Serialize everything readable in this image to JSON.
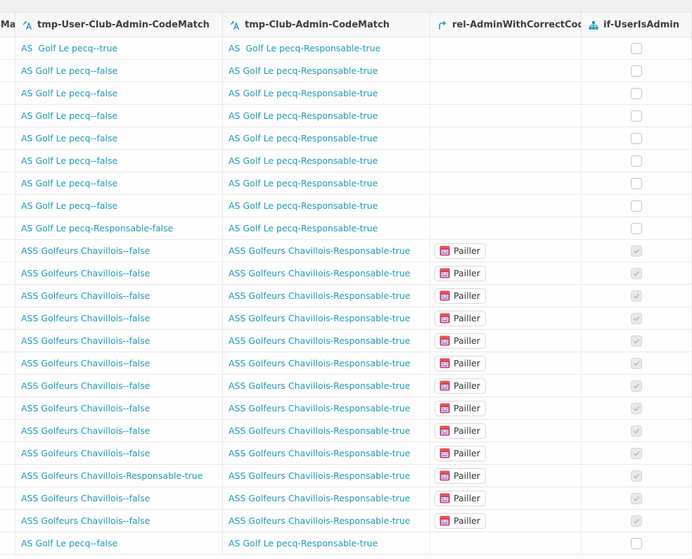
{
  "columns": {
    "cut": "eMa",
    "col1": "tmp-User-Club-Admin-CodeMatch",
    "col2": "tmp-Club-Admin-CodeMatch",
    "col3": "rel-AdminWithCorrectCode",
    "col4": "if-UserIsAdmin"
  },
  "icons": {
    "col1": "formula-text-icon",
    "col2": "formula-text-icon",
    "col3": "relation-arrow-icon",
    "col4": "hierarchy-icon",
    "chip": "calendar-avatar-icon"
  },
  "colors": {
    "link": "#1d9bb5",
    "header_icon": "#1d9bb5"
  },
  "rows": [
    {
      "a": "AS  Golf Le pecq--true",
      "b": "AS  Golf Le pecq-Responsable-true",
      "rel": "",
      "checked": false
    },
    {
      "a": "AS Golf Le pecq--false",
      "b": "AS Golf Le pecq-Responsable-true",
      "rel": "",
      "checked": false
    },
    {
      "a": "AS Golf Le pecq--false",
      "b": "AS Golf Le pecq-Responsable-true",
      "rel": "",
      "checked": false
    },
    {
      "a": "AS Golf Le pecq--false",
      "b": "AS Golf Le pecq-Responsable-true",
      "rel": "",
      "checked": false
    },
    {
      "a": "AS Golf Le pecq--false",
      "b": "AS Golf Le pecq-Responsable-true",
      "rel": "",
      "checked": false
    },
    {
      "a": "AS Golf Le pecq--false",
      "b": "AS Golf Le pecq-Responsable-true",
      "rel": "",
      "checked": false
    },
    {
      "a": "AS Golf Le pecq--false",
      "b": "AS Golf Le pecq-Responsable-true",
      "rel": "",
      "checked": false
    },
    {
      "a": "AS Golf Le pecq--false",
      "b": "AS Golf Le pecq-Responsable-true",
      "rel": "",
      "checked": false
    },
    {
      "a": "AS Golf Le pecq-Responsable-false",
      "b": "AS Golf Le pecq-Responsable-true",
      "rel": "",
      "checked": false
    },
    {
      "a": "ASS Golfeurs Chavillois--false",
      "b": "ASS Golfeurs Chavillois-Responsable-true",
      "rel": "Pailler",
      "checked": true
    },
    {
      "a": "ASS Golfeurs Chavillois--false",
      "b": "ASS Golfeurs Chavillois-Responsable-true",
      "rel": "Pailler",
      "checked": true
    },
    {
      "a": "ASS Golfeurs Chavillois--false",
      "b": "ASS Golfeurs Chavillois-Responsable-true",
      "rel": "Pailler",
      "checked": true
    },
    {
      "a": "ASS Golfeurs Chavillois--false",
      "b": "ASS Golfeurs Chavillois-Responsable-true",
      "rel": "Pailler",
      "checked": true
    },
    {
      "a": "ASS Golfeurs Chavillois--false",
      "b": "ASS Golfeurs Chavillois-Responsable-true",
      "rel": "Pailler",
      "checked": true
    },
    {
      "a": "ASS Golfeurs Chavillois--false",
      "b": "ASS Golfeurs Chavillois-Responsable-true",
      "rel": "Pailler",
      "checked": true
    },
    {
      "a": "ASS Golfeurs Chavillois--false",
      "b": "ASS Golfeurs Chavillois-Responsable-true",
      "rel": "Pailler",
      "checked": true
    },
    {
      "a": "ASS Golfeurs Chavillois--false",
      "b": "ASS Golfeurs Chavillois-Responsable-true",
      "rel": "Pailler",
      "checked": true
    },
    {
      "a": "ASS Golfeurs Chavillois--false",
      "b": "ASS Golfeurs Chavillois-Responsable-true",
      "rel": "Pailler",
      "checked": true
    },
    {
      "a": "ASS Golfeurs Chavillois--false",
      "b": "ASS Golfeurs Chavillois-Responsable-true",
      "rel": "Pailler",
      "checked": true
    },
    {
      "a": "ASS Golfeurs Chavillois-Responsable-true",
      "b": "ASS Golfeurs Chavillois-Responsable-true",
      "rel": "Pailler",
      "checked": true
    },
    {
      "a": "ASS Golfeurs Chavillois--false",
      "b": "ASS Golfeurs Chavillois-Responsable-true",
      "rel": "Pailler",
      "checked": true
    },
    {
      "a": "ASS Golfeurs Chavillois--false",
      "b": "ASS Golfeurs Chavillois-Responsable-true",
      "rel": "Pailler",
      "checked": true
    },
    {
      "a": "AS Golf Le pecq--false",
      "b": "AS Golf Le pecq-Responsable-true",
      "rel": "",
      "checked": false
    }
  ]
}
